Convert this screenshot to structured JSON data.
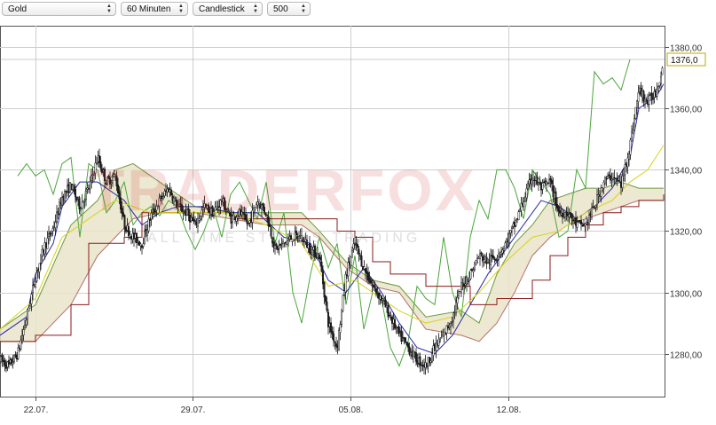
{
  "toolbar": {
    "instrument": "Gold",
    "interval": "60 Minuten",
    "chart_style": "Candlestick",
    "count": "500"
  },
  "watermark": {
    "logo": "TRADERFOX",
    "tagline": "ALL TIME STOCKS TRADING"
  },
  "colors": {
    "candle_up": "#ffffff",
    "candle_down": "#222222",
    "chikou": "#4aa63a",
    "kijun": "#8b1a1a",
    "tenkan": "#2a2aa8",
    "yellow_line": "#d9d21a",
    "cloud_fill": "#e9e4c9",
    "last_price_label_border": "#bca900"
  },
  "chart_data": {
    "type": "line",
    "subtype": "candlestick with ichimoku cloud",
    "title": "",
    "xlabel": "",
    "ylabel": "",
    "y_axis_position": "right",
    "ylim": [
      1266,
      1387
    ],
    "x_ticks": [
      {
        "label": "22.07.",
        "t": 40
      },
      {
        "label": "29.07.",
        "t": 217
      },
      {
        "label": "05.08.",
        "t": 395
      },
      {
        "label": "12.08.",
        "t": 573
      }
    ],
    "y_ticks": [
      "1380,00",
      "1360,00",
      "1340,00",
      "1320,00",
      "1300,00",
      "1280,00"
    ],
    "y_tick_values": [
      1380,
      1360,
      1340,
      1320,
      1300,
      1280
    ],
    "last_price_label": "1376,0",
    "last_price": 1376,
    "price_path": [
      [
        0,
        1278
      ],
      [
        10,
        1276
      ],
      [
        20,
        1280
      ],
      [
        30,
        1292
      ],
      [
        40,
        1305
      ],
      [
        50,
        1315
      ],
      [
        60,
        1321
      ],
      [
        70,
        1331
      ],
      [
        80,
        1335
      ],
      [
        90,
        1328
      ],
      [
        100,
        1334
      ],
      [
        110,
        1344
      ],
      [
        120,
        1336
      ],
      [
        130,
        1338
      ],
      [
        140,
        1322
      ],
      [
        150,
        1318
      ],
      [
        160,
        1316
      ],
      [
        170,
        1325
      ],
      [
        180,
        1330
      ],
      [
        190,
        1334
      ],
      [
        200,
        1328
      ],
      [
        210,
        1326
      ],
      [
        220,
        1322
      ],
      [
        230,
        1328
      ],
      [
        240,
        1326
      ],
      [
        250,
        1330
      ],
      [
        260,
        1324
      ],
      [
        270,
        1326
      ],
      [
        280,
        1322
      ],
      [
        290,
        1330
      ],
      [
        300,
        1326
      ],
      [
        310,
        1314
      ],
      [
        320,
        1316
      ],
      [
        330,
        1318
      ],
      [
        340,
        1318
      ],
      [
        350,
        1314
      ],
      [
        360,
        1312
      ],
      [
        370,
        1290
      ],
      [
        380,
        1282
      ],
      [
        390,
        1306
      ],
      [
        400,
        1316
      ],
      [
        410,
        1308
      ],
      [
        420,
        1302
      ],
      [
        430,
        1298
      ],
      [
        440,
        1292
      ],
      [
        450,
        1286
      ],
      [
        460,
        1282
      ],
      [
        470,
        1278
      ],
      [
        480,
        1276
      ],
      [
        490,
        1282
      ],
      [
        500,
        1286
      ],
      [
        510,
        1292
      ],
      [
        520,
        1302
      ],
      [
        530,
        1306
      ],
      [
        540,
        1312
      ],
      [
        550,
        1310
      ],
      [
        560,
        1312
      ],
      [
        570,
        1316
      ],
      [
        580,
        1322
      ],
      [
        590,
        1330
      ],
      [
        600,
        1338
      ],
      [
        610,
        1334
      ],
      [
        620,
        1336
      ],
      [
        630,
        1326
      ],
      [
        640,
        1326
      ],
      [
        650,
        1322
      ],
      [
        660,
        1322
      ],
      [
        670,
        1328
      ],
      [
        680,
        1336
      ],
      [
        690,
        1338
      ],
      [
        700,
        1335
      ],
      [
        710,
        1348
      ],
      [
        720,
        1366
      ],
      [
        730,
        1362
      ],
      [
        740,
        1366
      ],
      [
        748,
        1375
      ]
    ],
    "series": [
      {
        "name": "",
        "role": "chikou",
        "points": [
          [
            20,
            1338
          ],
          [
            30,
            1342
          ],
          [
            40,
            1338
          ],
          [
            50,
            1340
          ],
          [
            60,
            1332
          ],
          [
            70,
            1342
          ],
          [
            80,
            1344
          ],
          [
            90,
            1318
          ],
          [
            100,
            1342
          ],
          [
            110,
            1340
          ],
          [
            120,
            1326
          ],
          [
            130,
            1330
          ],
          [
            140,
            1336
          ],
          [
            150,
            1322
          ],
          [
            160,
            1326
          ],
          [
            170,
            1328
          ],
          [
            180,
            1325
          ],
          [
            190,
            1330
          ],
          [
            200,
            1328
          ],
          [
            210,
            1320
          ],
          [
            220,
            1314
          ],
          [
            230,
            1320
          ],
          [
            240,
            1328
          ],
          [
            250,
            1318
          ],
          [
            260,
            1332
          ],
          [
            270,
            1336
          ],
          [
            280,
            1330
          ],
          [
            290,
            1324
          ],
          [
            300,
            1336
          ],
          [
            310,
            1316
          ],
          [
            320,
            1326
          ],
          [
            330,
            1300
          ],
          [
            340,
            1290
          ],
          [
            350,
            1306
          ],
          [
            360,
            1318
          ],
          [
            370,
            1308
          ],
          [
            380,
            1316
          ],
          [
            390,
            1296
          ],
          [
            400,
            1312
          ],
          [
            410,
            1288
          ],
          [
            420,
            1300
          ],
          [
            430,
            1298
          ],
          [
            440,
            1282
          ],
          [
            450,
            1276
          ],
          [
            460,
            1284
          ],
          [
            470,
            1302
          ],
          [
            480,
            1298
          ],
          [
            490,
            1296
          ],
          [
            500,
            1318
          ],
          [
            510,
            1300
          ],
          [
            520,
            1292
          ],
          [
            530,
            1318
          ],
          [
            540,
            1330
          ],
          [
            550,
            1324
          ],
          [
            560,
            1340
          ],
          [
            570,
            1340
          ],
          [
            580,
            1334
          ],
          [
            590,
            1324
          ],
          [
            600,
            1340
          ],
          [
            610,
            1336
          ],
          [
            620,
            1332
          ],
          [
            630,
            1318
          ],
          [
            640,
            1320
          ],
          [
            650,
            1340
          ],
          [
            660,
            1334
          ],
          [
            670,
            1372
          ],
          [
            680,
            1368
          ],
          [
            690,
            1370
          ],
          [
            700,
            1366
          ],
          [
            710,
            1376
          ]
        ]
      },
      {
        "name": "",
        "role": "kijun",
        "points": [
          [
            0,
            1284
          ],
          [
            30,
            1284
          ],
          [
            40,
            1286
          ],
          [
            80,
            1296
          ],
          [
            100,
            1316
          ],
          [
            140,
            1318
          ],
          [
            160,
            1326
          ],
          [
            200,
            1326
          ],
          [
            260,
            1324
          ],
          [
            300,
            1324
          ],
          [
            340,
            1324
          ],
          [
            380,
            1320
          ],
          [
            400,
            1318
          ],
          [
            420,
            1310
          ],
          [
            440,
            1306
          ],
          [
            480,
            1302
          ],
          [
            510,
            1302
          ],
          [
            530,
            1296
          ],
          [
            560,
            1298
          ],
          [
            600,
            1304
          ],
          [
            620,
            1312
          ],
          [
            640,
            1318
          ],
          [
            660,
            1322
          ],
          [
            680,
            1326
          ],
          [
            700,
            1328
          ],
          [
            720,
            1330
          ],
          [
            748,
            1332
          ]
        ]
      },
      {
        "name": "",
        "role": "tenkan",
        "points": [
          [
            0,
            1286
          ],
          [
            30,
            1292
          ],
          [
            40,
            1306
          ],
          [
            60,
            1316
          ],
          [
            70,
            1328
          ],
          [
            90,
            1336
          ],
          [
            110,
            1336
          ],
          [
            140,
            1330
          ],
          [
            160,
            1322
          ],
          [
            180,
            1326
          ],
          [
            200,
            1328
          ],
          [
            230,
            1328
          ],
          [
            260,
            1326
          ],
          [
            290,
            1326
          ],
          [
            320,
            1318
          ],
          [
            350,
            1316
          ],
          [
            370,
            1304
          ],
          [
            390,
            1300
          ],
          [
            410,
            1308
          ],
          [
            430,
            1300
          ],
          [
            450,
            1290
          ],
          [
            470,
            1282
          ],
          [
            490,
            1280
          ],
          [
            510,
            1286
          ],
          [
            530,
            1296
          ],
          [
            550,
            1306
          ],
          [
            570,
            1314
          ],
          [
            590,
            1322
          ],
          [
            610,
            1330
          ],
          [
            630,
            1328
          ],
          [
            650,
            1324
          ],
          [
            670,
            1328
          ],
          [
            690,
            1334
          ],
          [
            710,
            1344
          ],
          [
            720,
            1360
          ],
          [
            740,
            1364
          ],
          [
            748,
            1368
          ]
        ]
      },
      {
        "name": "",
        "role": "yellow",
        "points": [
          [
            0,
            1288
          ],
          [
            40,
            1298
          ],
          [
            70,
            1318
          ],
          [
            100,
            1324
          ],
          [
            130,
            1330
          ],
          [
            170,
            1326
          ],
          [
            210,
            1326
          ],
          [
            260,
            1326
          ],
          [
            300,
            1322
          ],
          [
            340,
            1316
          ],
          [
            370,
            1302
          ],
          [
            400,
            1304
          ],
          [
            420,
            1300
          ],
          [
            450,
            1294
          ],
          [
            480,
            1290
          ],
          [
            510,
            1292
          ],
          [
            540,
            1300
          ],
          [
            570,
            1310
          ],
          [
            600,
            1318
          ],
          [
            630,
            1320
          ],
          [
            660,
            1326
          ],
          [
            690,
            1330
          ],
          [
            710,
            1336
          ],
          [
            730,
            1340
          ],
          [
            748,
            1348
          ]
        ]
      }
    ],
    "cloud_upper": [
      [
        0,
        1288
      ],
      [
        40,
        1296
      ],
      [
        80,
        1322
      ],
      [
        110,
        1330
      ],
      [
        130,
        1340
      ],
      [
        150,
        1342
      ],
      [
        180,
        1336
      ],
      [
        220,
        1328
      ],
      [
        260,
        1326
      ],
      [
        300,
        1326
      ],
      [
        340,
        1326
      ],
      [
        360,
        1320
      ],
      [
        390,
        1310
      ],
      [
        420,
        1304
      ],
      [
        450,
        1302
      ],
      [
        480,
        1292
      ],
      [
        520,
        1294
      ],
      [
        540,
        1290
      ],
      [
        560,
        1306
      ],
      [
        580,
        1316
      ],
      [
        600,
        1322
      ],
      [
        620,
        1330
      ],
      [
        640,
        1332
      ],
      [
        660,
        1334
      ],
      [
        680,
        1334
      ],
      [
        700,
        1336
      ],
      [
        720,
        1334
      ],
      [
        748,
        1334
      ]
    ],
    "cloud_lower": [
      [
        0,
        1284
      ],
      [
        40,
        1284
      ],
      [
        80,
        1296
      ],
      [
        110,
        1312
      ],
      [
        130,
        1318
      ],
      [
        150,
        1324
      ],
      [
        180,
        1326
      ],
      [
        220,
        1326
      ],
      [
        260,
        1324
      ],
      [
        300,
        1322
      ],
      [
        340,
        1322
      ],
      [
        360,
        1318
      ],
      [
        390,
        1308
      ],
      [
        420,
        1302
      ],
      [
        450,
        1300
      ],
      [
        480,
        1288
      ],
      [
        520,
        1286
      ],
      [
        540,
        1284
      ],
      [
        560,
        1290
      ],
      [
        580,
        1300
      ],
      [
        600,
        1312
      ],
      [
        620,
        1318
      ],
      [
        640,
        1322
      ],
      [
        660,
        1324
      ],
      [
        680,
        1326
      ],
      [
        700,
        1328
      ],
      [
        720,
        1330
      ],
      [
        748,
        1330
      ]
    ]
  }
}
